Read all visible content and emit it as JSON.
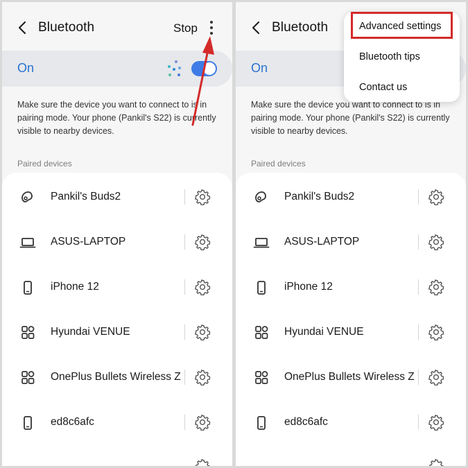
{
  "panels": [
    {
      "header": {
        "title": "Bluetooth",
        "stop_label": "Stop"
      },
      "status": {
        "label": "On"
      },
      "description": "Make sure the device you want to connect to is in pairing mode. Your phone (Pankil's S22) is currently visible to nearby devices.",
      "section_label": "Paired devices",
      "devices": [
        {
          "name": "Pankil's Buds2",
          "icon": "earbuds-icon"
        },
        {
          "name": "ASUS-LAPTOP",
          "icon": "laptop-icon"
        },
        {
          "name": "iPhone 12",
          "icon": "phone-icon"
        },
        {
          "name": "Hyundai VENUE",
          "icon": "apps-icon"
        },
        {
          "name": "OnePlus Bullets Wireless Z",
          "icon": "apps-icon"
        },
        {
          "name": "ed8c6afc",
          "icon": "phone-icon"
        }
      ]
    },
    {
      "header": {
        "title": "Bluetooth"
      },
      "status": {
        "label": "On"
      },
      "description": "Make sure the device you want to connect to is in pairing mode. Your phone (Pankil's S22) is currently visible to nearby devices.",
      "section_label": "Paired devices",
      "devices": [
        {
          "name": "Pankil's Buds2",
          "icon": "earbuds-icon"
        },
        {
          "name": "ASUS-LAPTOP",
          "icon": "laptop-icon"
        },
        {
          "name": "iPhone 12",
          "icon": "phone-icon"
        },
        {
          "name": "Hyundai VENUE",
          "icon": "apps-icon"
        },
        {
          "name": "OnePlus Bullets Wireless Z",
          "icon": "apps-icon"
        },
        {
          "name": "ed8c6afc",
          "icon": "phone-icon"
        }
      ],
      "menu": {
        "items": [
          "Advanced settings",
          "Bluetooth tips",
          "Contact us"
        ]
      }
    }
  ],
  "colors": {
    "accent": "#3e7be6",
    "on_text": "#2a71d0",
    "annotation": "#d42a2a"
  }
}
